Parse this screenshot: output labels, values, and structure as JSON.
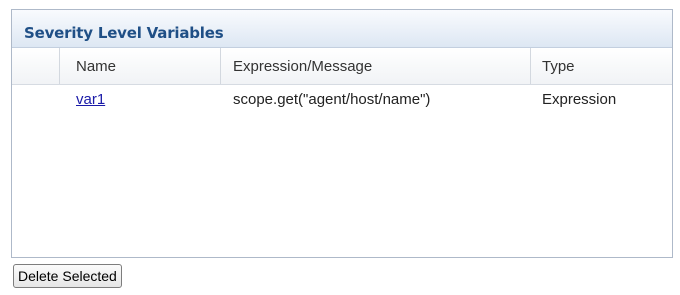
{
  "panel": {
    "title": "Severity Level Variables"
  },
  "table": {
    "columns": [
      "Name",
      "Expression/Message",
      "Type"
    ],
    "rows": [
      {
        "name": "var1",
        "expression": "scope.get(\"agent/host/name\")",
        "type": "Expression"
      }
    ]
  },
  "actions": {
    "delete_label": "Delete Selected"
  }
}
